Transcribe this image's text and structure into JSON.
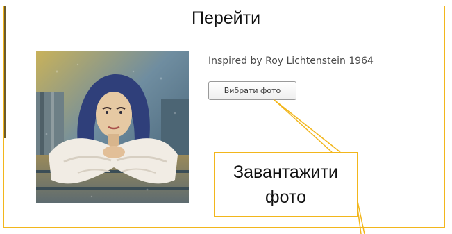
{
  "header": {
    "title": "Перейти"
  },
  "main": {
    "caption": "Inspired by Roy Lichtenstein 1964",
    "upload_button_label": "Вибрати фото"
  },
  "callout": {
    "line1": "Завантажити",
    "line2": "фото"
  },
  "photo": {
    "icon": "portrait-photo-icon"
  },
  "colors": {
    "accent": "#f2b61c",
    "text": "#111111",
    "button_border": "#9a9a9a"
  }
}
